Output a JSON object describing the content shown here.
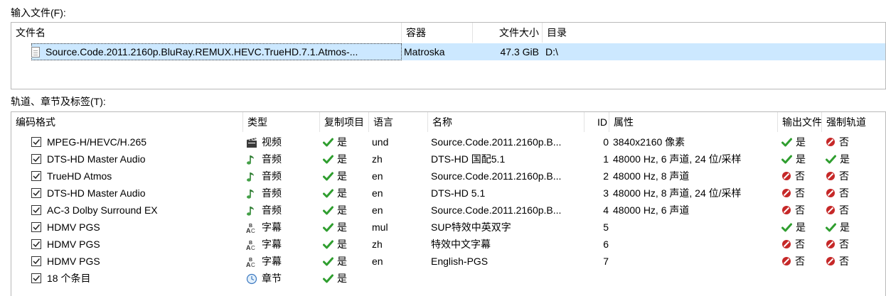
{
  "input_files": {
    "label": "输入文件(F):",
    "columns": [
      "文件名",
      "容器",
      "文件大小",
      "目录"
    ],
    "rows": [
      {
        "name": "Source.Code.2011.2160p.BluRay.REMUX.HEVC.TrueHD.7.1.Atmos-...",
        "container": "Matroska",
        "size": "47.3 GiB",
        "directory": "D:\\"
      }
    ]
  },
  "tracks": {
    "label": "轨道、章节及标签(T):",
    "columns": [
      "编码格式",
      "类型",
      "复制项目",
      "语言",
      "名称",
      "ID",
      "属性",
      "输出文件",
      "强制轨道"
    ],
    "rows": [
      {
        "codec": "MPEG-H/HEVC/H.265",
        "type_icon": "video-icon",
        "type": "视频",
        "copy": "是",
        "copy_flag": "yes",
        "lang": "und",
        "name": "Source.Code.2011.2160p.B...",
        "id": "0",
        "props": "3840x2160 像素",
        "default": "是",
        "default_flag": "yes",
        "forced": "否",
        "forced_flag": "no"
      },
      {
        "codec": "DTS-HD Master Audio",
        "type_icon": "audio-icon",
        "type": "音频",
        "copy": "是",
        "copy_flag": "yes",
        "lang": "zh",
        "name": "DTS-HD 国配5.1",
        "id": "1",
        "props": "48000 Hz, 6 声道, 24 位/采样",
        "default": "是",
        "default_flag": "yes",
        "forced": "是",
        "forced_flag": "yes"
      },
      {
        "codec": "TrueHD Atmos",
        "type_icon": "audio-icon",
        "type": "音频",
        "copy": "是",
        "copy_flag": "yes",
        "lang": "en",
        "name": "Source.Code.2011.2160p.B...",
        "id": "2",
        "props": "48000 Hz, 8 声道",
        "default": "否",
        "default_flag": "no",
        "forced": "否",
        "forced_flag": "no"
      },
      {
        "codec": "DTS-HD Master Audio",
        "type_icon": "audio-icon",
        "type": "音频",
        "copy": "是",
        "copy_flag": "yes",
        "lang": "en",
        "name": "DTS-HD 5.1",
        "id": "3",
        "props": "48000 Hz, 8 声道, 24 位/采样",
        "default": "否",
        "default_flag": "no",
        "forced": "否",
        "forced_flag": "no"
      },
      {
        "codec": "AC-3 Dolby Surround EX",
        "type_icon": "audio-icon",
        "type": "音频",
        "copy": "是",
        "copy_flag": "yes",
        "lang": "en",
        "name": "Source.Code.2011.2160p.B...",
        "id": "4",
        "props": "48000 Hz, 6 声道",
        "default": "否",
        "default_flag": "no",
        "forced": "否",
        "forced_flag": "no"
      },
      {
        "codec": "HDMV PGS",
        "type_icon": "subtitle-icon",
        "type": "字幕",
        "copy": "是",
        "copy_flag": "yes",
        "lang": "mul",
        "name": "SUP特效中英双字",
        "id": "5",
        "props": "",
        "default": "是",
        "default_flag": "yes",
        "forced": "是",
        "forced_flag": "yes"
      },
      {
        "codec": "HDMV PGS",
        "type_icon": "subtitle-icon",
        "type": "字幕",
        "copy": "是",
        "copy_flag": "yes",
        "lang": "zh",
        "name": "特效中文字幕",
        "id": "6",
        "props": "",
        "default": "否",
        "default_flag": "no",
        "forced": "否",
        "forced_flag": "no"
      },
      {
        "codec": "HDMV PGS",
        "type_icon": "subtitle-icon",
        "type": "字幕",
        "copy": "是",
        "copy_flag": "yes",
        "lang": "en",
        "name": "English-PGS",
        "id": "7",
        "props": "",
        "default": "否",
        "default_flag": "no",
        "forced": "否",
        "forced_flag": "no"
      },
      {
        "codec": "18 个条目",
        "type_icon": "chapter-icon",
        "type": "章节",
        "copy": "是",
        "copy_flag": "yes",
        "lang": "",
        "name": "",
        "id": "",
        "props": "",
        "default": "",
        "default_flag": "",
        "forced": "",
        "forced_flag": ""
      }
    ]
  },
  "colors": {
    "selected_row": "#cce8ff",
    "yes_green": "#2f9e2f",
    "no_red": "#c62828"
  }
}
